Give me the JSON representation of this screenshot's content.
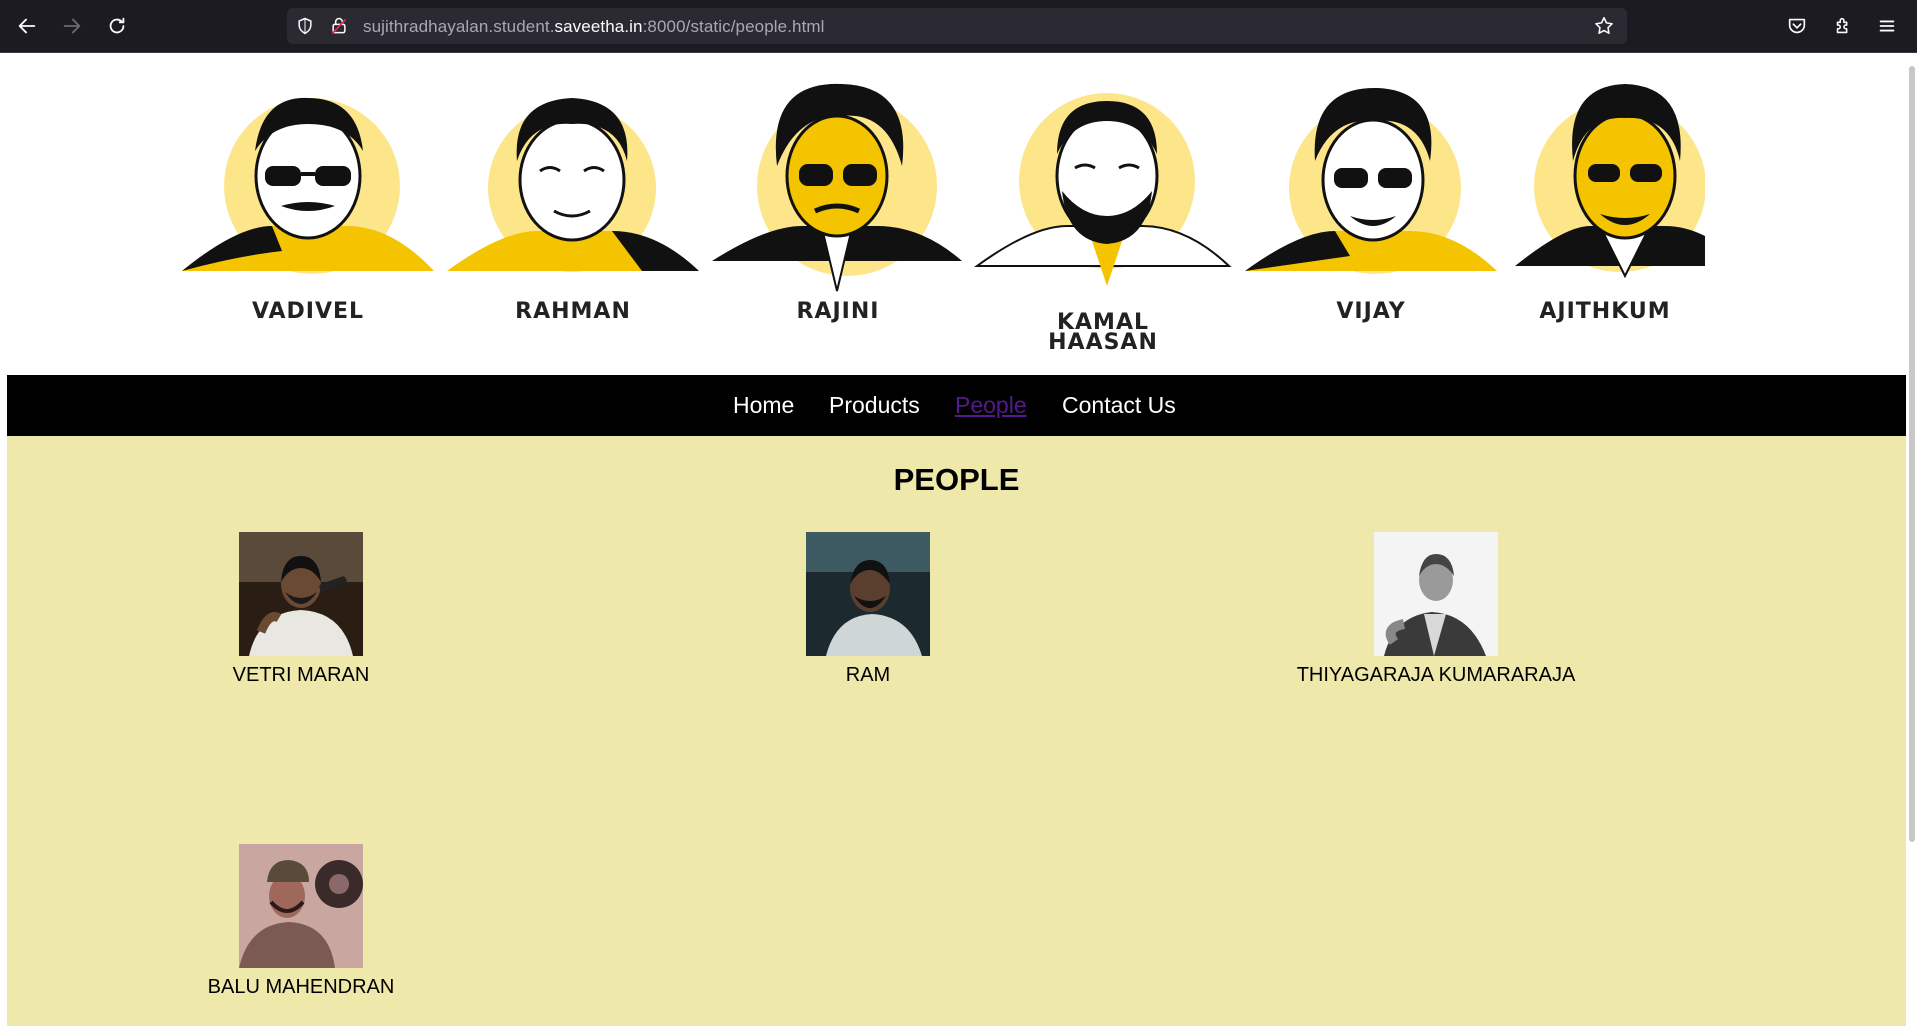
{
  "browser": {
    "url_prefix": "sujithradhayalan.student.",
    "url_domain": "saveetha.in",
    "url_suffix": ":8000/static/people.html"
  },
  "banner": {
    "actors": [
      {
        "name_line1": "VADIVEL",
        "name_line2": ""
      },
      {
        "name_line1": "RAHMAN",
        "name_line2": ""
      },
      {
        "name_line1": "RAJINI",
        "name_line2": ""
      },
      {
        "name_line1": "KAMAL",
        "name_line2": "HAASAN"
      },
      {
        "name_line1": "VIJAY",
        "name_line2": ""
      },
      {
        "name_line1": "AJITHKUM",
        "name_line2": ""
      }
    ],
    "accent_color": "#fde58a"
  },
  "nav": {
    "items": [
      {
        "label": "Home"
      },
      {
        "label": "Products"
      },
      {
        "label": "People"
      },
      {
        "label": "Contact Us"
      }
    ],
    "active": "People"
  },
  "main": {
    "heading": "PEOPLE",
    "people": [
      {
        "name": "VETRI MARAN"
      },
      {
        "name": "RAM"
      },
      {
        "name": "THIYAGARAJA KUMARARAJA"
      },
      {
        "name": "BALU MAHENDRAN"
      }
    ],
    "background": "#eee8aa"
  }
}
